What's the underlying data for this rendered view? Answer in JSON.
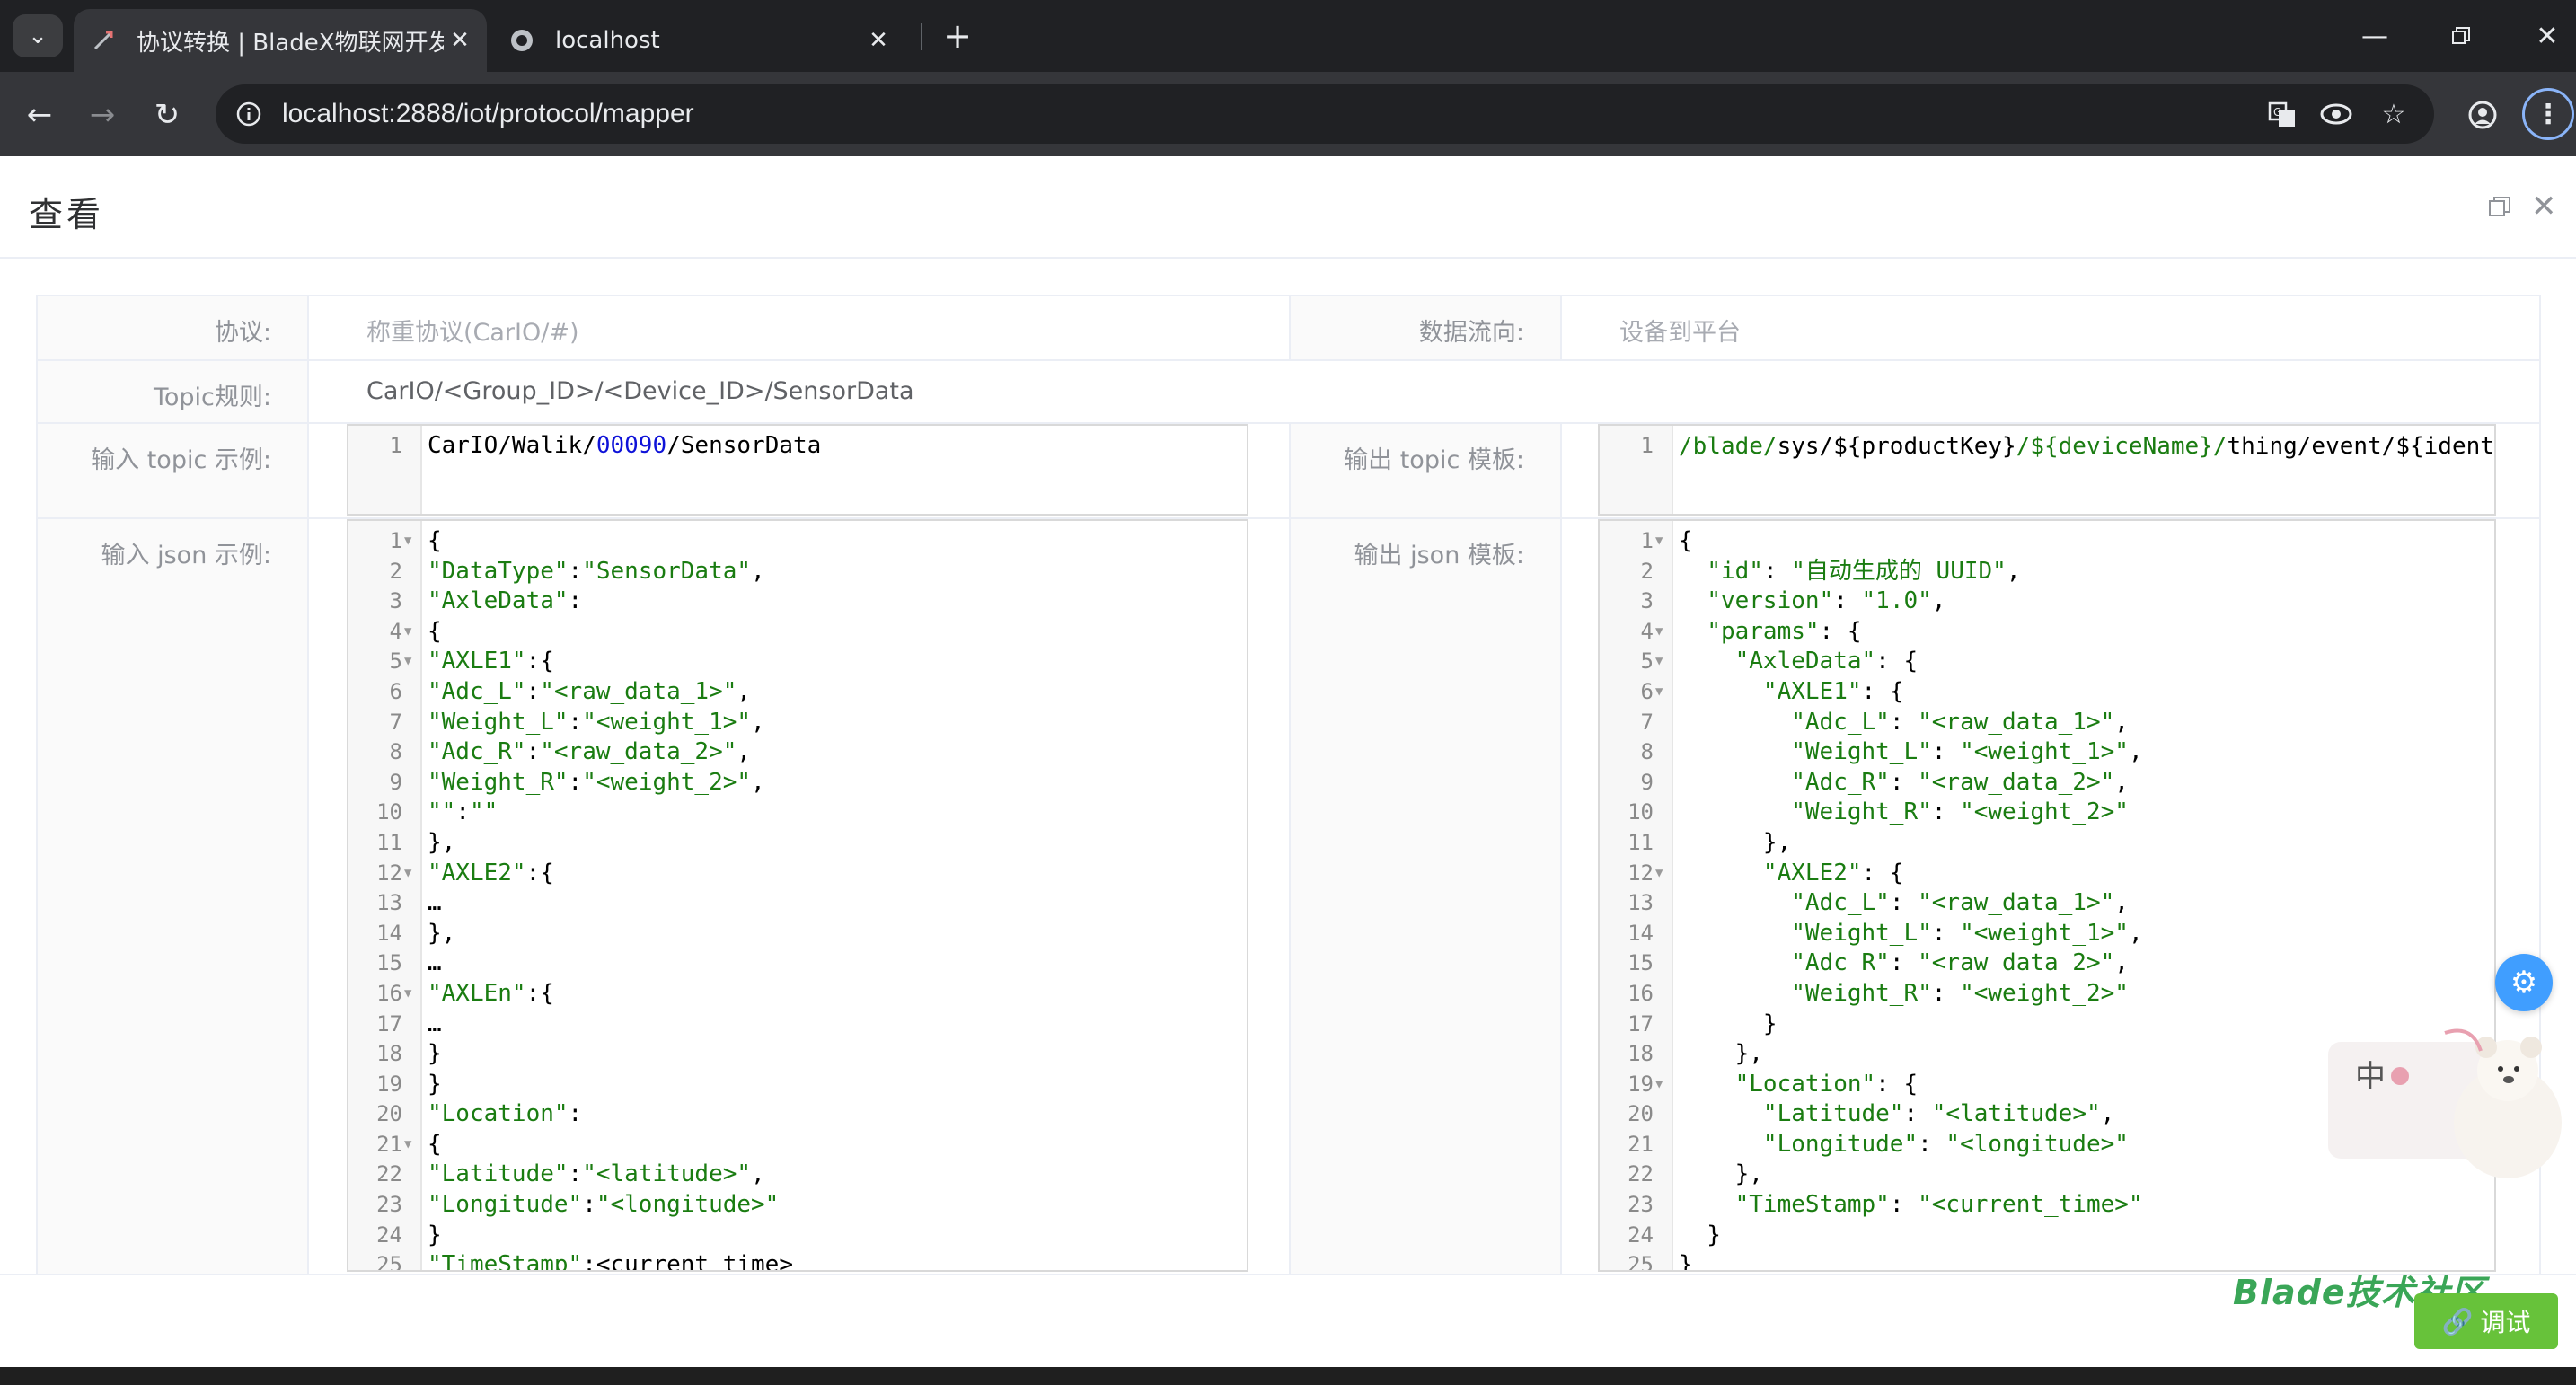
{
  "browser": {
    "tabs": [
      {
        "title": "协议转换 | BladeX物联网开发平台",
        "active": true
      },
      {
        "title": "localhost",
        "active": false
      }
    ],
    "url": "localhost:2888/iot/protocol/mapper",
    "icons": [
      "tab-search-icon",
      "close-icon",
      "plus-icon",
      "minimize-icon",
      "restore-icon",
      "back-icon",
      "forward-icon",
      "reload-icon",
      "site-info-icon",
      "translate-icon",
      "eye-icon",
      "star-icon",
      "profile-icon",
      "kebab-icon"
    ]
  },
  "dialog": {
    "title": "查看",
    "rows": {
      "protocol_label": "协议:",
      "protocol_value": "称重协议(CarIO/#)",
      "direction_label": "数据流向:",
      "direction_value": "设备到平台",
      "topic_rule_label": "Topic规则:",
      "topic_rule_value": "CarIO/<Group_ID>/<Device_ID>/SensorData",
      "input_topic_label": "输入 topic 示例:",
      "output_topic_label": "输出 topic 模板:",
      "input_json_label": "输入 json 示例:",
      "output_json_label": "输出 json 模板:"
    },
    "input_topic_lines": [
      "CarIO/Walik/00090/SensorData"
    ],
    "output_topic_lines": [
      "/blade/sys/${productKey}/${deviceName}/thing/event/${identifier}/post"
    ],
    "input_json_lines": [
      "{",
      "\"DataType\":\"SensorData\",",
      "\"AxleData\":",
      "{",
      "\"AXLE1\":{",
      "\"Adc_L\":\"<raw_data_1>\",",
      "\"Weight_L\":\"<weight_1>\",",
      "\"Adc_R\":\"<raw_data_2>\",",
      "\"Weight_R\":\"<weight_2>\",",
      "\"\":\"\"",
      "},",
      "\"AXLE2\":{",
      "…",
      "},",
      "…",
      "\"AXLEn\":{",
      "…",
      "}",
      "}",
      "\"Location\":",
      "{",
      "\"Latitude\":\"<latitude>\",",
      "\"Longitude\":\"<longitude>\"",
      "}",
      "\"TimeStamp\":<current_time>"
    ],
    "input_json_folds": [
      1,
      4,
      5,
      12,
      16,
      21
    ],
    "output_json_lines": [
      "{",
      "  \"id\": \"自动生成的 UUID\",",
      "  \"version\": \"1.0\",",
      "  \"params\": {",
      "    \"AxleData\": {",
      "      \"AXLE1\": {",
      "        \"Adc_L\": \"<raw_data_1>\",",
      "        \"Weight_L\": \"<weight_1>\",",
      "        \"Adc_R\": \"<raw_data_2>\",",
      "        \"Weight_R\": \"<weight_2>\"",
      "      },",
      "      \"AXLE2\": {",
      "        \"Adc_L\": \"<raw_data_1>\",",
      "        \"Weight_L\": \"<weight_1>\",",
      "        \"Adc_R\": \"<raw_data_2>\",",
      "        \"Weight_R\": \"<weight_2>\"",
      "      }",
      "    },",
      "    \"Location\": {",
      "      \"Latitude\": \"<latitude>\",",
      "      \"Longitude\": \"<longitude>\"",
      "    },",
      "    \"TimeStamp\": \"<current_time>\"",
      "  }",
      "}"
    ],
    "output_json_folds": [
      1,
      4,
      5,
      6,
      12,
      19
    ],
    "watermark": "Blade技术社区",
    "debug_button": "调试",
    "sticker_text": "中"
  }
}
